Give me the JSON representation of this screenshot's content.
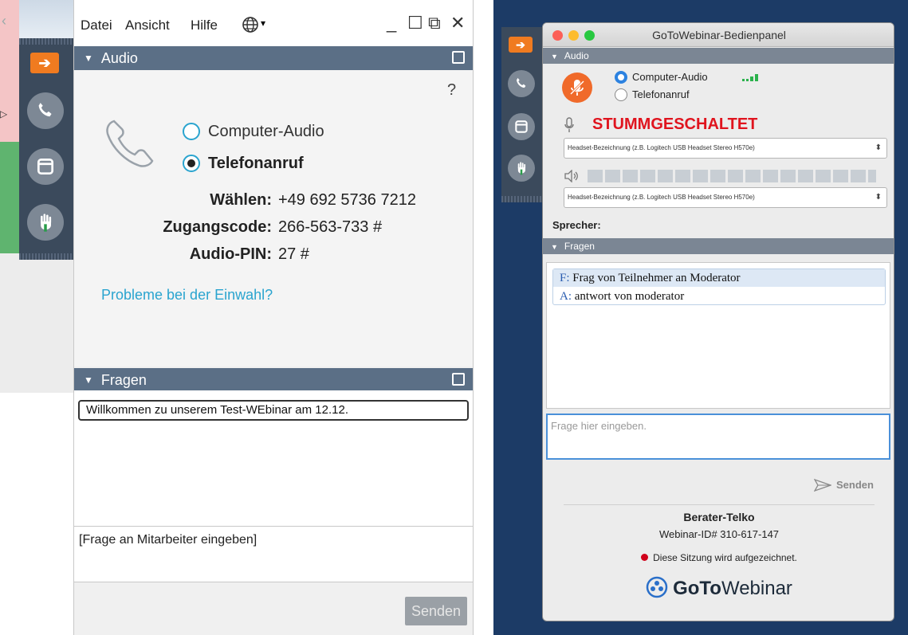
{
  "left": {
    "menu": {
      "datei": "Datei",
      "ansicht": "Ansicht",
      "hilfe": "Hilfe"
    },
    "window_controls": {
      "minimize": "_",
      "maximize": "☐",
      "popout": "⧉",
      "close": "✕"
    },
    "audio": {
      "header": "Audio",
      "help": "?",
      "options": [
        {
          "label": "Computer-Audio",
          "selected": false
        },
        {
          "label": "Telefonanruf",
          "selected": true
        }
      ],
      "dial_label": "Wählen:",
      "dial_value": "+49 692 5736 7212",
      "access_label": "Zugangscode:",
      "access_value": "266-563-733 #",
      "pin_label": "Audio-PIN:",
      "pin_value": "27 #",
      "problem_link": "Probleme bei der Einwahl?"
    },
    "fragen": {
      "header": "Fragen",
      "message": "Willkommen zu unserem Test-WEbinar am 12.12.",
      "input_placeholder": "[Frage an Mitarbeiter eingeben]",
      "send": "Senden"
    },
    "colors": {
      "header": "#5b6f86",
      "strip": "#3b4a5c",
      "accent": "#f07b20",
      "link": "#2aa4cf"
    }
  },
  "right": {
    "title": "GoToWebinar-Bedienpanel",
    "audio": {
      "header": "Audio",
      "options": [
        {
          "label": "Computer-Audio",
          "selected": true
        },
        {
          "label": "Telefonanruf",
          "selected": false
        }
      ],
      "muted": "STUMMGESCHALTET",
      "mic_device": "Headset-Bezeichnung (z.B. Logitech USB Headset Stereo H570e)",
      "speaker_device": "Headset-Bezeichnung (z.B. Logitech USB Headset Stereo H570e)",
      "speaker_label": "Sprecher:"
    },
    "fragen": {
      "header": "Fragen",
      "q_prefix": "F:",
      "question": "Frag von Teilnehmer an Moderator",
      "a_prefix": "A:",
      "answer": "antwort von moderator",
      "input_placeholder": "Frage hier eingeben.",
      "send": "Senden"
    },
    "footer": {
      "org": "Berater-Telko",
      "webinar_id": "Webinar-ID# 310-617-147",
      "recording": "Diese Sitzung wird aufgezeichnet.",
      "logo_goto": "GoTo",
      "logo_webinar": "Webinar"
    },
    "colors": {
      "muted": "#e0141e",
      "selected_radio": "#2c82e0",
      "mute_button": "#f06a2a",
      "recording_dot": "#d0021b"
    }
  }
}
